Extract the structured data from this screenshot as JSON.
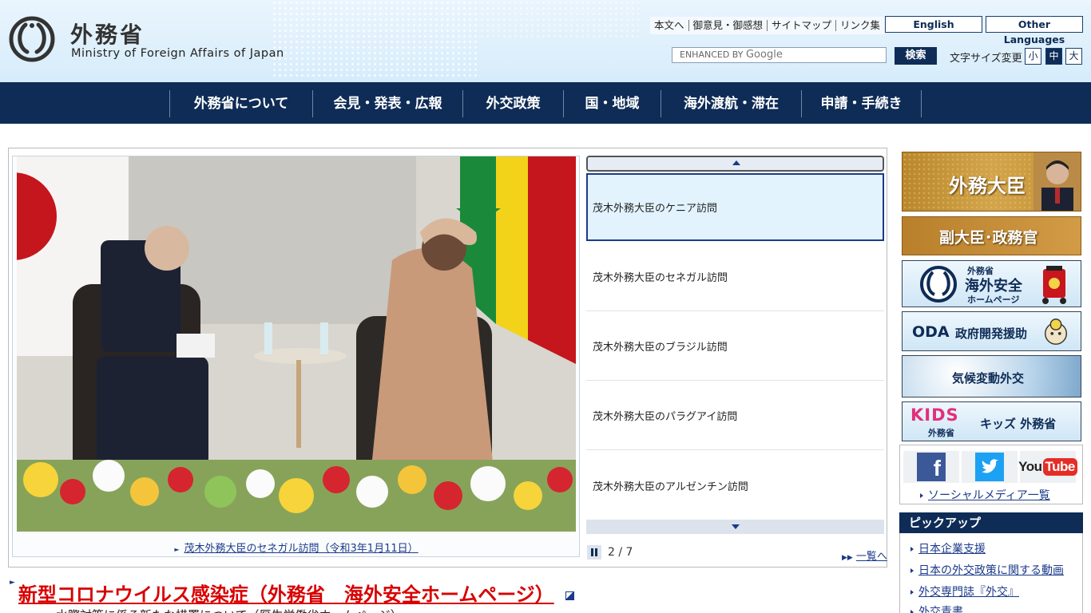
{
  "header": {
    "logo_jp": "外務省",
    "logo_en": "Ministry of Foreign Affairs of Japan",
    "util_links": [
      "本文へ",
      "御意見・御感想",
      "サイトマップ",
      "リンク集"
    ],
    "english_label": "English",
    "other_languages_label": "Other Languages",
    "search_placeholder_prefix": "ENHANCED BY",
    "search_placeholder_brand": "Google",
    "search_button": "検索",
    "fontsize_label": "文字サイズ変更",
    "fontsize_small": "小",
    "fontsize_medium": "中",
    "fontsize_large": "大"
  },
  "nav": {
    "items": [
      "外務省について",
      "会見・発表・広報",
      "外交政策",
      "国・地域",
      "海外渡航・滞在",
      "申請・手続き"
    ]
  },
  "slider": {
    "caption": "茂木外務大臣のセネガル訪問（令和3年1月11日）",
    "items": [
      "茂木外務大臣のケニア訪問",
      "茂木外務大臣のセネガル訪問",
      "茂木外務大臣のブラジル訪問",
      "茂木外務大臣のパラグアイ訪問",
      "茂木外務大臣のアルゼンチン訪問"
    ],
    "counter": "2 / 7",
    "list_link": "一覧へ"
  },
  "corona": {
    "title": "新型コロナウイルス感染症（外務省　海外安全ホームページ）",
    "subtitle": "・水際対策に係る新たな措置について（厚生労働省ホームページ）"
  },
  "sidebar": {
    "minister": "外務大臣",
    "vice": "副大臣･政務官",
    "anzen_line1": "外務省",
    "anzen_line2": "海外安全",
    "anzen_line3": "ホームページ",
    "oda_abbr": "ODA",
    "oda_text": "政府開発援助",
    "kikou": "気候変動外交",
    "kids_logo": "KIDS",
    "kids_sub": "外務省",
    "kids_text": "キッズ 外務省",
    "social_facebook": "f",
    "social_youtube_you": "You",
    "social_youtube_tube": "Tube",
    "social_link": "ソーシャルメディア一覧"
  },
  "pickup": {
    "heading": "ピックアップ",
    "items": [
      "日本企業支援",
      "日本の外交政策に関する動画",
      "外交専門誌『外交』",
      "外交青書"
    ]
  },
  "colors": {
    "navy": "#0e2c56",
    "link": "#1a3a8a",
    "corona_red": "#d80000",
    "gold": "#c38f35"
  }
}
